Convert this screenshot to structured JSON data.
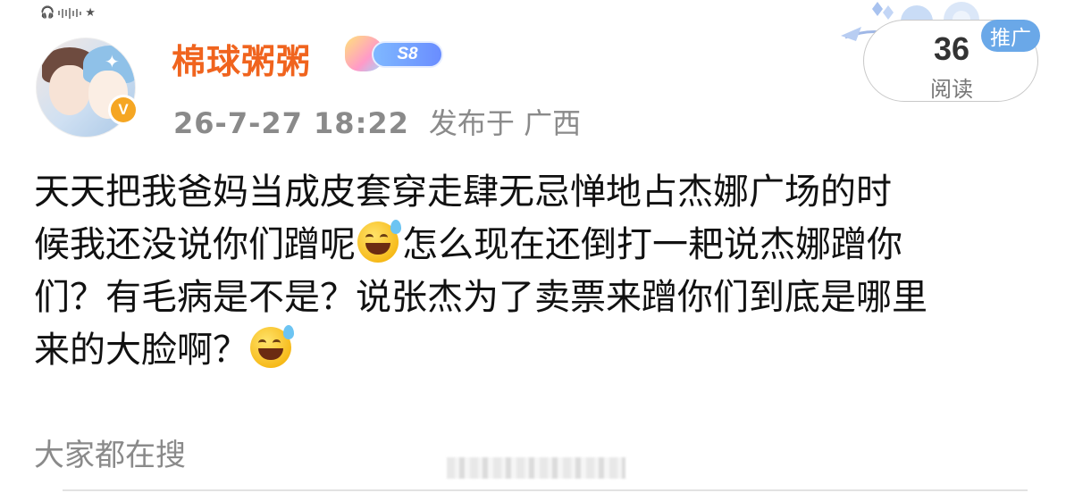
{
  "header": {
    "username": "棉球粥粥",
    "level_badge": "S8",
    "verified_mark": "V",
    "timestamp": "26-7-27 18:22",
    "published_label": "发布于",
    "location": "广西"
  },
  "stats": {
    "read_count": "36",
    "read_label": "阅读",
    "promo_label": "推广"
  },
  "post": {
    "lines": [
      "天天把我爸妈当成皮套穿走肆无忌惮地占杰娜广场的时",
      "候我还没说你们蹭呢",
      "怎么现在还倒打一耙说杰娜蹭你",
      "们？有毛病是不是？说张杰为了卖票来蹭你们到底是哪里",
      "来的大脸啊？"
    ],
    "emojis": [
      "sweat-smile-emoji",
      "sweat-smile-emoji"
    ]
  },
  "footer": {
    "search_label": "大家都在搜"
  },
  "colors": {
    "username": "#f0641e",
    "promo_bg": "#6aa8e8",
    "meta_text": "#8a8a8a",
    "verified": "#f5a623"
  }
}
